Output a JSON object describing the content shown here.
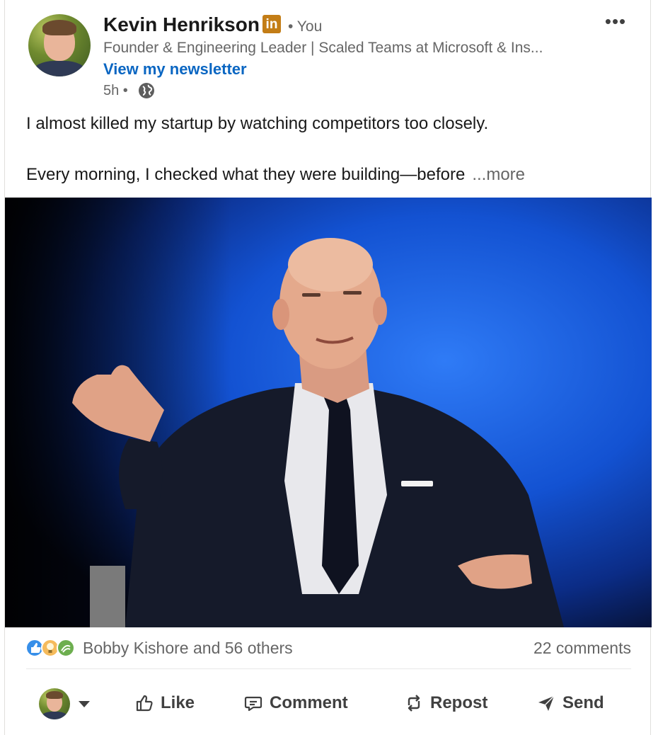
{
  "author": {
    "name": "Kevin Henrikson",
    "badge": "in",
    "relation": "• You",
    "headline": "Founder & Engineering Leader | Scaled Teams at Microsoft & Ins...",
    "newsletter_link": "View my newsletter",
    "time": "5h •"
  },
  "post": {
    "line1": "I almost killed my startup by watching competitors too closely.",
    "line2": "Every morning, I checked what they were building—before",
    "see_more": "...more"
  },
  "social": {
    "reactions_text": "Bobby Kishore and 56 others",
    "comments_text": "22 comments",
    "reaction_icons": [
      "like-icon",
      "insightful-icon",
      "celebrate-icon"
    ]
  },
  "actions": {
    "like": "Like",
    "comment": "Comment",
    "repost": "Repost",
    "send": "Send"
  },
  "colors": {
    "link": "#0a66c2",
    "muted": "#666666",
    "badge": "#c37d16",
    "photo_bg": "#1453d6"
  }
}
